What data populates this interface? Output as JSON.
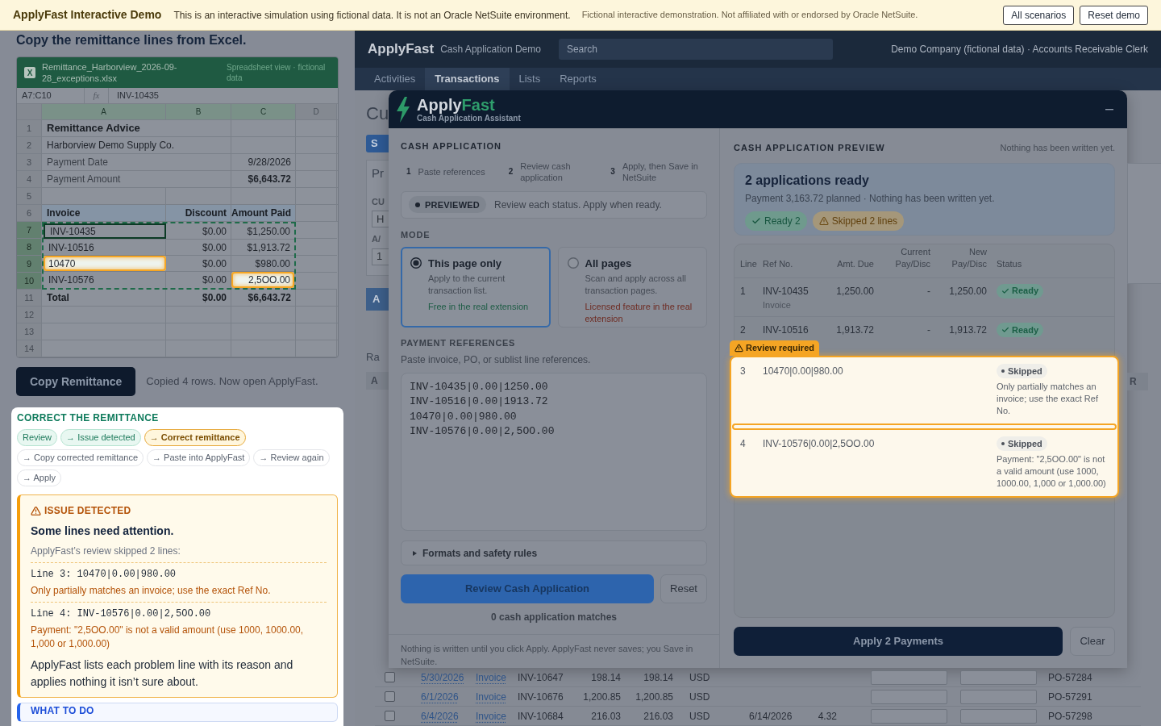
{
  "banner": {
    "title": "ApplyFast Interactive Demo",
    "notice": "This is an interactive simulation using fictional data. It is not an Oracle NetSuite environment.",
    "disclaimer": "Fictional interactive demonstration. Not affiliated with or endorsed by Oracle NetSuite.",
    "buttons": [
      "All scenarios",
      "Reset demo"
    ]
  },
  "guide": {
    "heading": "Copy the remittance lines from Excel.",
    "spreadsheet": {
      "badge": "X",
      "file_name": "Remittance_Harborview_2026-09-28_exceptions.xlsx",
      "view_note": "Spreadsheet view · fictional data",
      "name_box": "A7:C10",
      "fx": "fx",
      "formula": "INV-10435",
      "columns": [
        {
          "label": "A",
          "selected": true
        },
        {
          "label": "B",
          "selected": true
        },
        {
          "label": "C",
          "selected": true
        },
        {
          "label": "D",
          "selected": false
        }
      ],
      "rows": [
        {
          "number": "1",
          "kind": "title",
          "selected": false,
          "cells": [
            "Remittance Advice",
            null,
            null,
            null
          ]
        },
        {
          "number": "2",
          "kind": "text",
          "selected": false,
          "cells": [
            "Harborview Demo Supply Co.",
            null,
            null,
            null
          ]
        },
        {
          "number": "3",
          "kind": "label",
          "selected": false,
          "cells": [
            "Payment Date",
            null,
            "9/28/2026",
            null
          ]
        },
        {
          "number": "4",
          "kind": "amount",
          "selected": false,
          "cells": [
            "Payment Amount",
            null,
            "$6,643.72",
            null
          ]
        },
        {
          "number": "5",
          "kind": "blank",
          "selected": false
        },
        {
          "number": "6",
          "kind": "header",
          "selected": false,
          "cells": [
            "Invoice",
            "Discount",
            "Amount Paid",
            null
          ]
        },
        {
          "number": "7",
          "kind": "data",
          "selected": true,
          "cells": [
            {
              "text": "INV-10435",
              "active": true,
              "flagged": false
            },
            {
              "text": "$0.00",
              "active": false,
              "flagged": false
            },
            {
              "text": "$1,250.00",
              "active": false,
              "flagged": false
            },
            null
          ]
        },
        {
          "number": "8",
          "kind": "data",
          "selected": true,
          "cells": [
            {
              "text": "INV-10516",
              "active": false,
              "flagged": false
            },
            {
              "text": "$0.00",
              "active": false,
              "flagged": false
            },
            {
              "text": "$1,913.72",
              "active": false,
              "flagged": false
            },
            null
          ]
        },
        {
          "number": "9",
          "kind": "data",
          "selected": true,
          "cells": [
            {
              "text": "10470",
              "active": false,
              "flagged": true
            },
            {
              "text": "$0.00",
              "active": false,
              "flagged": false
            },
            {
              "text": "$980.00",
              "active": false,
              "flagged": false
            },
            null
          ]
        },
        {
          "number": "10",
          "kind": "data",
          "selected": true,
          "cells": [
            {
              "text": "INV-10576",
              "active": false,
              "flagged": false
            },
            {
              "text": "$0.00",
              "active": false,
              "flagged": false
            },
            {
              "text": "2,5OO.00",
              "active": false,
              "flagged": true
            },
            null
          ]
        },
        {
          "number": "11",
          "kind": "total",
          "selected": false,
          "cells": [
            "Total",
            "$0.00",
            "$6,643.72",
            null
          ]
        },
        {
          "number": "12",
          "kind": "blank",
          "selected": false
        },
        {
          "number": "13",
          "kind": "blank",
          "selected": false
        },
        {
          "number": "14",
          "kind": "blank",
          "selected": false
        }
      ]
    },
    "copy_button": "Copy Remittance",
    "copy_status": "Copied 4 rows. Now open ApplyFast."
  },
  "walkthrough": {
    "title": "CORRECT THE REMITTANCE",
    "steps": [
      {
        "label": "Review",
        "completed": true,
        "current": false
      },
      {
        "label": "→ Issue detected",
        "completed": true,
        "current": false
      },
      {
        "label": "→ Correct remittance",
        "completed": false,
        "current": true
      },
      {
        "label": "→ Copy corrected remittance",
        "completed": false,
        "current": false
      },
      {
        "label": "→ Paste into ApplyFast",
        "completed": false,
        "current": false
      },
      {
        "label": "→ Review again",
        "completed": false,
        "current": false
      },
      {
        "label": "→ Apply",
        "completed": false,
        "current": false
      }
    ],
    "issue": {
      "label": "ISSUE DETECTED",
      "heading": "Some lines need attention.",
      "intro": "ApplyFast’s review skipped 2 lines:",
      "lines": [
        {
          "code": "Line 3: 10470|0.00|980.00",
          "reason": "Only partially matches an invoice; use the exact Ref No."
        },
        {
          "code": "Line 4: INV-10576|0.00|2,5OO.00",
          "reason": "Payment: \"2,5OO.00\" is not a valid amount (use 1000, 1000.00, 1,000 or 1,000.00)"
        }
      ],
      "summary": "ApplyFast lists each problem line with its reason and applies nothing it isn’t sure about."
    },
    "what_to_do": {
      "title": "WHAT TO DO"
    }
  },
  "netsuite": {
    "brand": "ApplyFast",
    "product": "Cash Application Demo",
    "search": {
      "placeholder": "Search"
    },
    "account": "Demo Company (fictional data) · Accounts Receivable Clerk",
    "tabs": [
      {
        "label": "Activities",
        "selected": false
      },
      {
        "label": "Transactions",
        "selected": true
      },
      {
        "label": "Lists",
        "selected": false
      },
      {
        "label": "Reports",
        "selected": false
      }
    ]
  },
  "page_fragments": {
    "left": {
      "title": "Cu",
      "button": "S",
      "panel_title": "Pr",
      "label_1": "CU",
      "field_1": "H",
      "label_2": "A/",
      "field_2": "1",
      "tab": "A",
      "section": "Ra",
      "column": "A"
    },
    "right": {
      "column": "R"
    }
  },
  "assistant": {
    "logo": {
      "first": "Apply",
      "second": "Fast"
    },
    "subtitle": "Cash Application Assistant",
    "form": {
      "title": "CASH APPLICATION",
      "steps": [
        {
          "number": "1",
          "label": "Paste references"
        },
        {
          "number": "2",
          "label": "Review cash application"
        },
        {
          "number": "3",
          "label": "Apply, then Save in NetSuite"
        }
      ],
      "status": {
        "badge": "PREVIEWED",
        "message": "Review each status. Apply when ready."
      },
      "mode": {
        "title": "MODE",
        "options": [
          {
            "title": "This page only",
            "description": "Apply to the current transaction list.",
            "note": "Free in the real extension",
            "kind": "free",
            "selected": true
          },
          {
            "title": "All pages",
            "description": "Scan and apply across all transaction pages.",
            "note": "Licensed feature in the real extension",
            "kind": "licensed",
            "selected": false
          }
        ]
      },
      "references": {
        "title": "PAYMENT REFERENCES",
        "hint": "Paste invoice, PO, or sublist line references.",
        "value": "INV-10435|0.00|1250.00\nINV-10516|0.00|1913.72\n10470|0.00|980.00\nINV-10576|0.00|2,5OO.00"
      },
      "rules": {
        "label": "Formats and safety rules",
        "expanded": false
      },
      "buttons": {
        "primary": "Review Cash Application",
        "secondary": "Reset"
      },
      "match_count": "0 cash application matches",
      "footer": "Nothing is written until you click Apply. ApplyFast never saves; you Save in NetSuite."
    },
    "preview": {
      "title": "CASH APPLICATION PREVIEW",
      "note": "Nothing has been written yet.",
      "summary": {
        "heading": "2 applications ready",
        "detail": "Payment 3,163.72 planned · Nothing has been written yet.",
        "badges": [
          {
            "kind": "ready",
            "label": "Ready 2"
          },
          {
            "kind": "skipped",
            "label": "Skipped 2 lines"
          }
        ]
      },
      "columns": [
        "Line",
        "Ref No.",
        "Amt. Due",
        "Current Pay/Disc",
        "New Pay/Disc",
        "Status"
      ],
      "rows": [
        {
          "kind": "ready",
          "line": "1",
          "ref": "INV-10435",
          "type": "Invoice",
          "amount_due": "1,250.00",
          "current": "-",
          "new": "1,250.00",
          "status": "Ready"
        },
        {
          "kind": "ready",
          "line": "2",
          "ref": "INV-10516",
          "amount_due": "1,913.72",
          "current": "-",
          "new": "1,913.72",
          "status": "Ready"
        },
        {
          "kind": "skipped",
          "line": "3",
          "ref": "10470|0.00|980.00",
          "status": "Skipped",
          "reason": "Only partially matches an invoice; use the exact Ref No."
        },
        {
          "kind": "skipped",
          "line": "4",
          "ref": "INV-10576|0.00|2,5OO.00",
          "status": "Skipped",
          "reason": "Payment: \"2,5OO.00\" is not a valid amount (use 1000, 1000.00, 1,000 or 1,000.00)"
        }
      ],
      "review_badge": "Review required",
      "buttons": {
        "primary": "Apply 2 Payments",
        "secondary": "Clear"
      }
    }
  },
  "transactions": [
    {
      "checked": false,
      "cells": [
        "5/30/2026",
        "Invoice",
        "INV-10647",
        "198.14",
        "198.14",
        "USD",
        null,
        null,
        "PO-57284"
      ]
    },
    {
      "checked": false,
      "cells": [
        "6/1/2026",
        "Invoice",
        "INV-10676",
        "1,200.85",
        "1,200.85",
        "USD",
        null,
        null,
        "PO-57291"
      ]
    },
    {
      "checked": false,
      "cells": [
        "6/4/2026",
        "Invoice",
        "INV-10684",
        "216.03",
        "216.03",
        "USD",
        "6/14/2026",
        "4.32",
        "PO-57298"
      ]
    }
  ]
}
